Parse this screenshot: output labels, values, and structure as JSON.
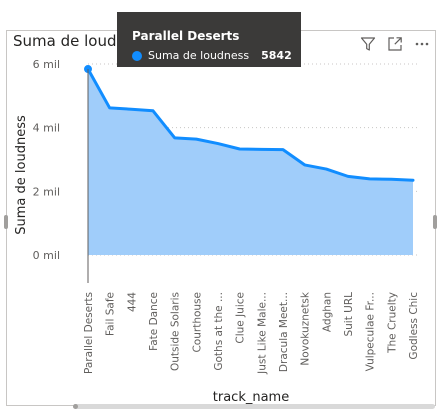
{
  "visual": {
    "title": "Suma de loudness por track_name"
  },
  "tooltip": {
    "title": "Parallel Deserts",
    "series_label": "Suma de loudness",
    "value": "5842"
  },
  "icons": {
    "filter": "filter-icon",
    "focus": "focus-mode-icon",
    "more": "more-options-icon"
  },
  "chart_data": {
    "type": "area",
    "title": "Suma de loudness por track_name",
    "xlabel": "track_name",
    "ylabel": "Suma de loudness",
    "ylim": [
      0,
      6000
    ],
    "yticks": [
      0,
      2000,
      4000,
      6000
    ],
    "ytick_labels": [
      "0 mil",
      "2 mil",
      "4 mil",
      "6 mil"
    ],
    "grid": true,
    "line_color": "#118dff",
    "fill_color": "#a0cdfa",
    "highlighted_category": "Parallel Deserts",
    "categories": [
      "Parallel Deserts",
      "Fail Safe",
      "444",
      "Fate Dance",
      "Outside Solaris",
      "Courthouse",
      "Goths at the ...",
      "Clue Juice",
      "Just Like Male...",
      "Dracula Meet...",
      "Novokuznetsk",
      "Adghan",
      "Suit URL",
      "Vulpeculae Fr...",
      "The Cruelty",
      "Godless Chic"
    ],
    "series": [
      {
        "name": "Suma de loudness",
        "values": [
          5842,
          4620,
          4580,
          4530,
          3680,
          3640,
          3500,
          3330,
          3320,
          3310,
          2830,
          2700,
          2470,
          2390,
          2380,
          2350
        ]
      }
    ]
  }
}
